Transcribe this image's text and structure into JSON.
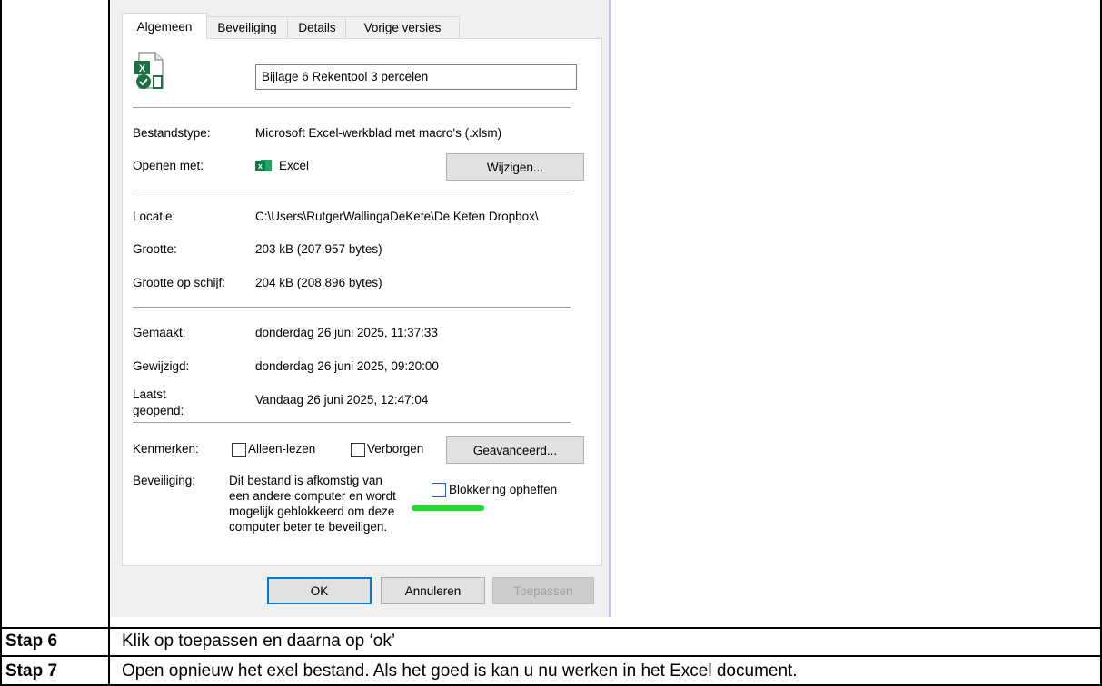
{
  "dialog": {
    "tabs": [
      "Algemeen",
      "Beveiliging",
      "Details",
      "Vorige versies"
    ],
    "file_name": "Bijlage 6 Rekentool 3 percelen",
    "file_icon": "excel-macro-file-icon",
    "rows": {
      "type_label": "Bestandstype:",
      "type_value": "Microsoft Excel-werkblad met macro's (.xlsm)",
      "open_label": "Openen met:",
      "open_app_icon": "excel-icon",
      "open_value": "Excel",
      "change_button": "Wijzigen...",
      "location_label": "Locatie:",
      "location_value": "C:\\Users\\RutgerWallingaDeKete\\De Keten Dropbox\\",
      "size_label": "Grootte:",
      "size_value": "203 kB (207.957 bytes)",
      "disk_size_label": "Grootte op schijf:",
      "disk_size_value": "204 kB (208.896 bytes)",
      "created_label": "Gemaakt:",
      "created_value": "donderdag 26 juni 2025, 11:37:33",
      "modified_label": "Gewijzigd:",
      "modified_value": "donderdag 26 juni 2025, 09:20:00",
      "accessed_label_1": "Laatst",
      "accessed_label_2": "geopend:",
      "accessed_value": "Vandaag 26 juni 2025, 12:47:04",
      "attributes_label": "Kenmerken:",
      "readonly_label": "Alleen-lezen",
      "hidden_label": "Verborgen",
      "advanced_button": "Geavanceerd...",
      "security_label": "Beveiliging:",
      "security_text_lines": [
        "Dit bestand is afkomstig van",
        "een andere computer en wordt",
        "mogelijk geblokkeerd om deze",
        "computer beter te beveiligen."
      ],
      "unblock_label": "Blokkering opheffen"
    },
    "buttons": {
      "ok": "OK",
      "cancel": "Annuleren",
      "apply": "Toepassen"
    },
    "highlight_color": "#18e02a"
  },
  "steps": [
    {
      "label": "Stap 6",
      "text": "Klik op toepassen en daarna op ‘ok’"
    },
    {
      "label": "Stap 7",
      "text": "Open opnieuw het exel bestand. Als het goed is kan u nu werken in het Excel document."
    }
  ]
}
